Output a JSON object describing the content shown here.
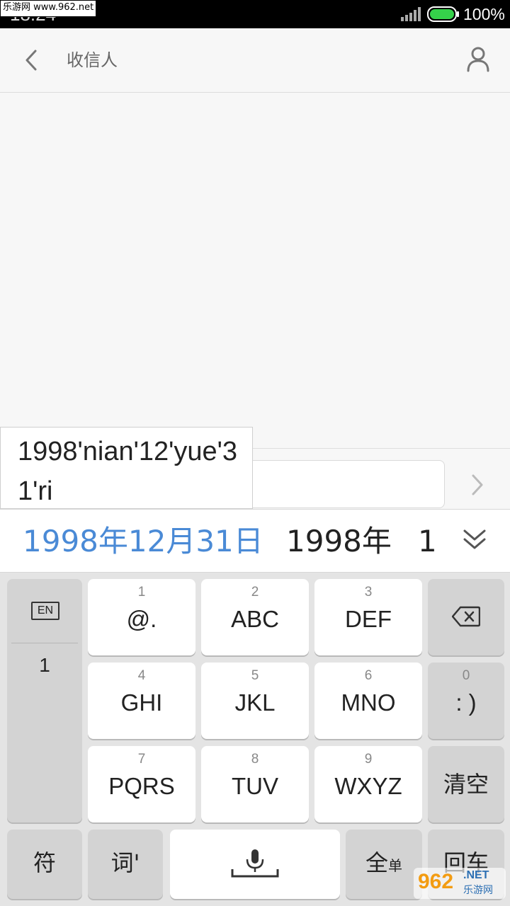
{
  "status_bar": {
    "time": "18:24",
    "battery_percent": "100%",
    "battery_level": 1.0,
    "battery_color": "#35d24a",
    "watermark_text": "乐游网 www.962.net"
  },
  "header": {
    "title": "收信人",
    "back_icon": "chevron-left-icon",
    "contact_icon": "person-icon"
  },
  "compose": {
    "send_icon": "chevron-right-icon"
  },
  "ime": {
    "composing_text": "1998'nian'12'yue'31'ri",
    "candidates": [
      "1998年12月31日",
      "1998年",
      "1"
    ],
    "highlight_color": "#4a8ad6",
    "expand_icon": "double-chevron-down-icon",
    "left_panel": {
      "lang_label": "EN",
      "candidates": [
        "1"
      ]
    },
    "keys": [
      {
        "num": "1",
        "label": "@."
      },
      {
        "num": "2",
        "label": "ABC"
      },
      {
        "num": "3",
        "label": "DEF"
      },
      {
        "num": "4",
        "label": "GHI"
      },
      {
        "num": "5",
        "label": "JKL"
      },
      {
        "num": "6",
        "label": "MNO"
      },
      {
        "num": "7",
        "label": "PQRS"
      },
      {
        "num": "8",
        "label": "TUV"
      },
      {
        "num": "9",
        "label": "WXYZ"
      },
      {
        "num": "0",
        "label": ": )"
      }
    ],
    "clear_label": "清空",
    "symbol_label": "符",
    "word_label": "词'",
    "width_label": "全",
    "width_sub_label": "单",
    "enter_label": "回车",
    "backspace_icon": "backspace-icon",
    "mic_icon": "microphone-icon"
  },
  "watermark": {
    "logo_num": "962",
    "logo_net": ".NET",
    "logo_cn": "乐游网"
  }
}
